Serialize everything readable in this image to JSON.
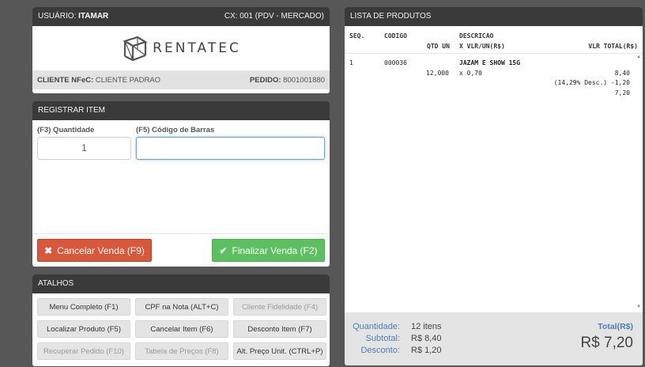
{
  "header": {
    "user_label": "USUÁRIO:",
    "user_name": "ITAMAR",
    "caixa": "CX: 001 (PDV - MERCADO)",
    "logo_text": "RENTATEC",
    "cliente_label": "CLIENTE NFeC:",
    "cliente_value": "CLIENTE PADRAO",
    "pedido_label": "PEDIDO:",
    "pedido_value": "8001001880"
  },
  "registrar": {
    "title": "REGISTRAR ITEM",
    "qty_label": "(F3) Quantidade",
    "qty_value": "1",
    "barcode_label": "(F5) Código de Barras",
    "barcode_value": "",
    "cancel_label": "Cancelar Venda (F9)",
    "finish_label": "Finalizar Venda (F2)",
    "colors": {
      "cancel": "#d9573a",
      "finish": "#5cbf60"
    }
  },
  "atalhos": {
    "title": "ATALHOS",
    "buttons": [
      {
        "label": "Menu Completo (F1)"
      },
      {
        "label": "CPF na Nota (ALT+C)"
      },
      {
        "label": "Cliente Fidelidade (F4)"
      },
      {
        "label": "Localizar Produto (F5)"
      },
      {
        "label": "Cancelar Item (F6)"
      },
      {
        "label": "Desconto Item (F7)"
      },
      {
        "label": "Recuperar Pedido (F10)"
      },
      {
        "label": "Tabela de Preços (F8)"
      },
      {
        "label": "Alt. Preço Unit. (CTRL+P)"
      }
    ]
  },
  "lista": {
    "title": "LISTA DE PRODUTOS",
    "columns": {
      "seq": "SEQ.",
      "codigo": "CODIGO",
      "descricao": "DESCRICAO",
      "qtd_un": "QTD UN",
      "vlr_un": "X VLR/UN(R$)",
      "vlr_total": "VLR TOTAL(R$)"
    },
    "items": [
      {
        "seq": "1",
        "codigo": "000036",
        "descricao": "JAZAM E SHOW 15G",
        "qtd": "12,000",
        "vlr_un": "x 0,70",
        "bruto": "8,40",
        "desconto": "(14,29% Desc.) -1,20",
        "total": "7,20"
      }
    ]
  },
  "totals": {
    "quantidade_label": "Quantidade:",
    "quantidade_value": "12 itens",
    "subtotal_label": "Subtotal:",
    "subtotal_value": "R$ 8,40",
    "desconto_label": "Desconto:",
    "desconto_value": "R$ 1,20",
    "total_label": "Total(R$)",
    "total_value": "R$ 7,20"
  }
}
